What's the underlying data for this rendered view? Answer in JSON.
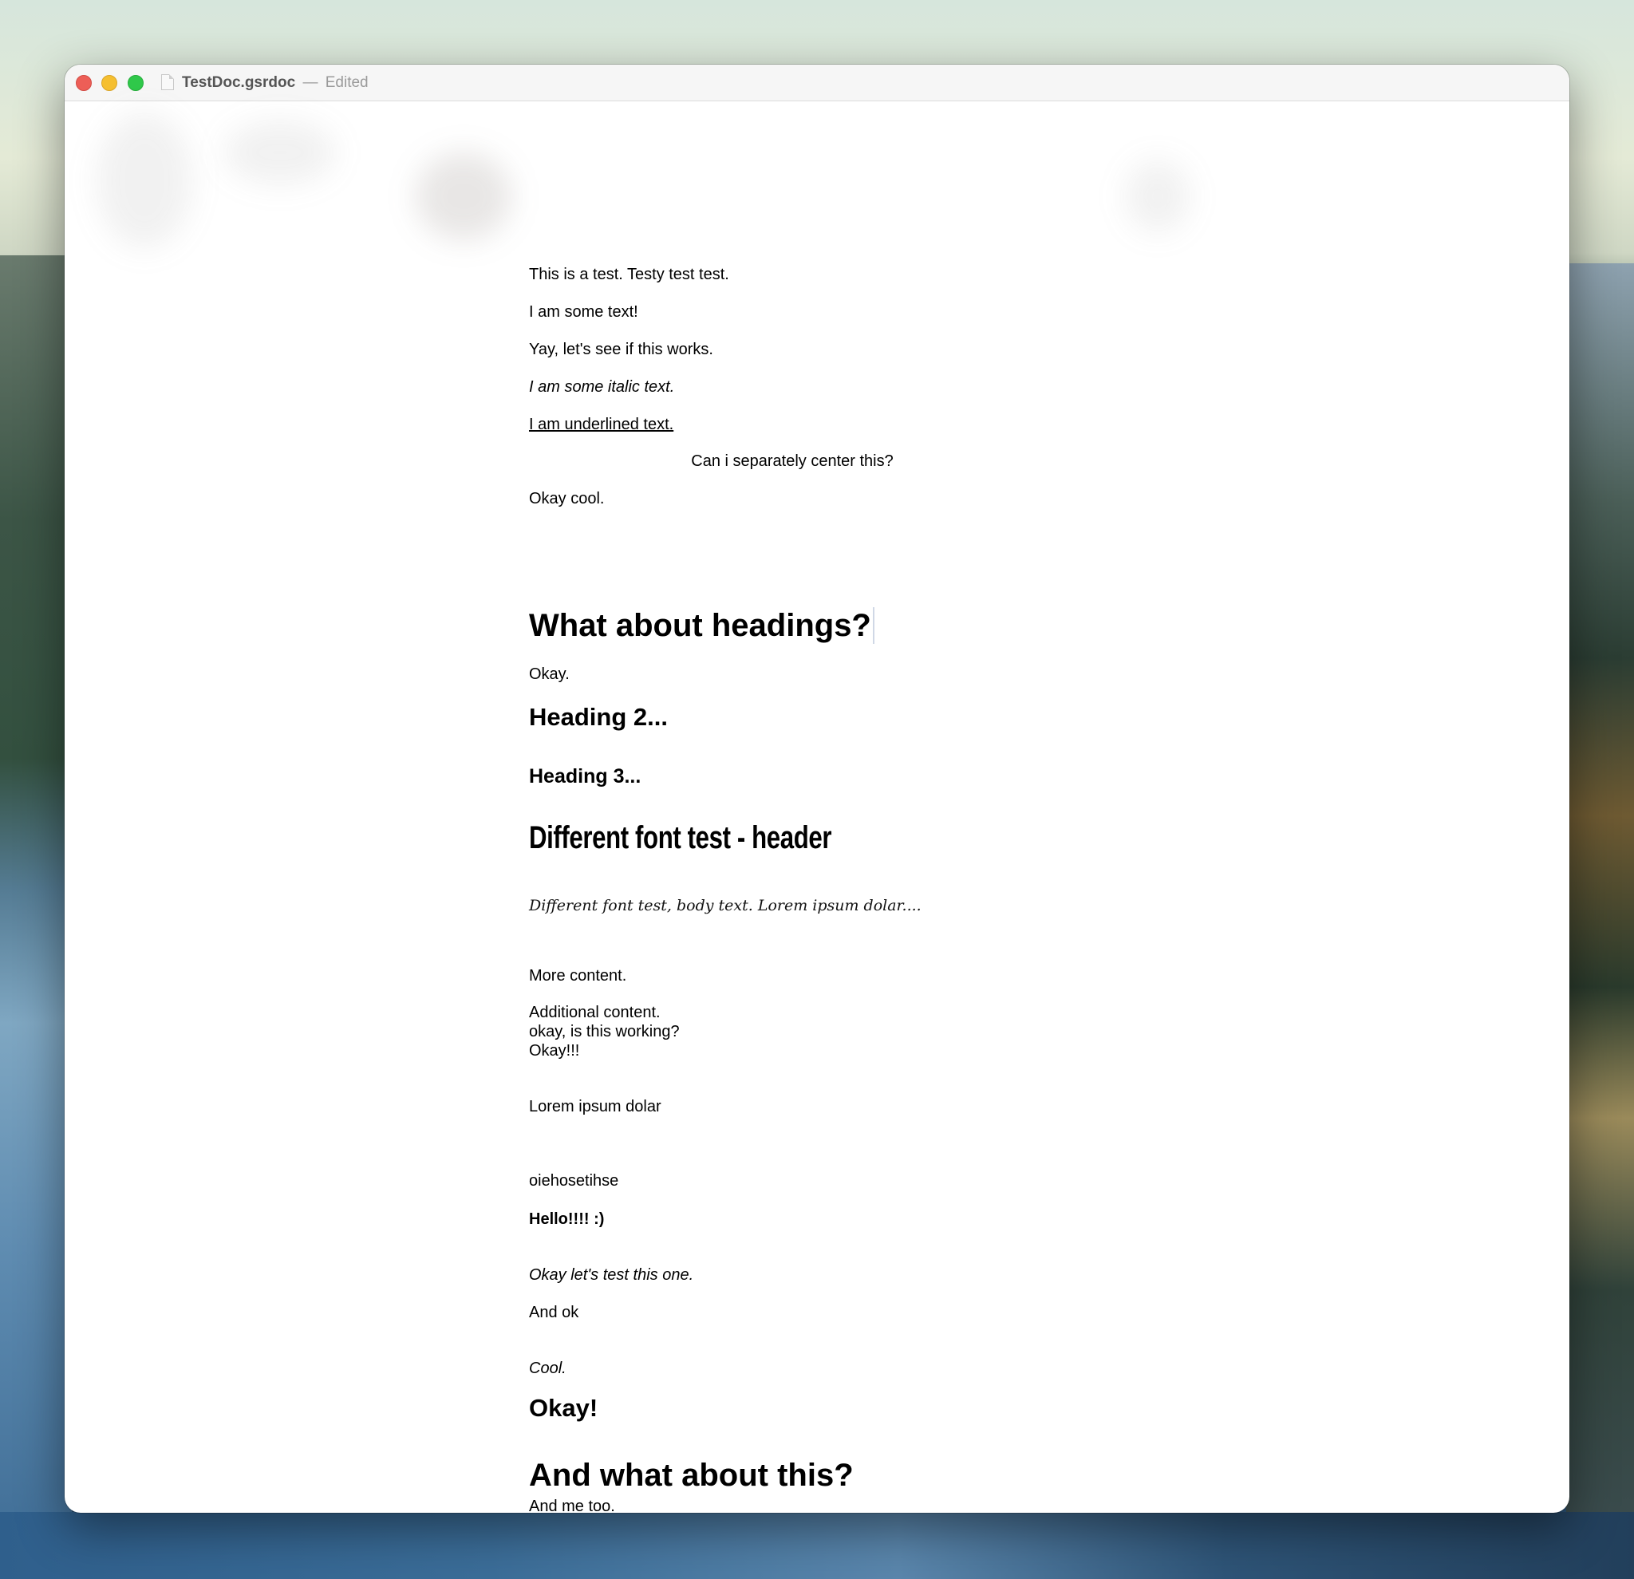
{
  "window": {
    "filename": "TestDoc.gsrdoc",
    "separator": "—",
    "status": "Edited"
  },
  "document": {
    "p1": "This is a test. Testy test test.",
    "p2": "I am some text!",
    "p3": "Yay, let's see if this works.",
    "p4": "I am some italic text.",
    "p5": "I am underlined text.",
    "p6": "Can i separately center this?",
    "p7": "Okay cool.",
    "h1a": "What about headings?",
    "p8": "Okay.",
    "h2a": "Heading 2...",
    "h3a": "Heading 3...",
    "fontHeader": "Different font test - header",
    "fontBody": "Different font test, body text. Lorem ipsum dolar....",
    "p9": "More content.",
    "p10a": "Additional content.",
    "p10b": "okay, is this working?",
    "p10c": "Okay!!!",
    "p11": "Lorem ipsum dolar",
    "p12": "oiehosetihse",
    "p13": "Hello!!!! :)",
    "p14": "Okay let's test this one.",
    "p15": "And ok",
    "p16": "Cool.",
    "h2b": "Okay!",
    "h1b": "And what about this?",
    "p17": "And me too."
  }
}
